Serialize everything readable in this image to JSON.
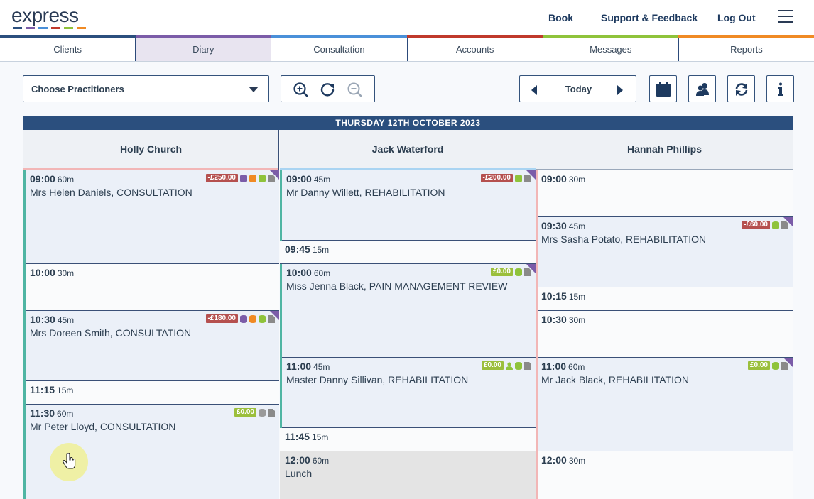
{
  "brand": {
    "logo_text": "express",
    "stripe_colors": [
      "#2b4f7e",
      "#7b5ca8",
      "#4a90d9",
      "#c0392b",
      "#8fc33b",
      "#f08a24"
    ]
  },
  "top_nav": {
    "book": "Book",
    "support": "Support & Feedback",
    "logout": "Log Out"
  },
  "tabs": [
    {
      "label": "Clients"
    },
    {
      "label": "Diary",
      "active": true
    },
    {
      "label": "Consultation"
    },
    {
      "label": "Accounts"
    },
    {
      "label": "Messages"
    },
    {
      "label": "Reports"
    }
  ],
  "toolbar": {
    "practitioners_label": "Choose Practitioners",
    "today_label": "Today",
    "icons": [
      "zoom-in-icon",
      "refresh-icon",
      "zoom-out-icon",
      "calendar-icon",
      "users-icon",
      "sync-icon",
      "info-icon"
    ]
  },
  "date_header": "THURSDAY 12TH OCTOBER 2023",
  "practitioners": [
    {
      "name": "Holly Church",
      "color": "#f2b6b6",
      "slots": [
        {
          "time": "09:00",
          "dur": "60m",
          "who": "Mrs Helen Daniels, CONSULTATION",
          "money": "-£250.00",
          "coins": [
            "#7b5ca8",
            "#f08a24",
            "#8fc33b"
          ],
          "booked": true
        },
        {
          "time": "10:00",
          "dur": "30m"
        },
        {
          "time": "10:30",
          "dur": "45m",
          "who": "Mrs Doreen Smith, CONSULTATION",
          "money": "-£180.00",
          "coins": [
            "#7b5ca8",
            "#f08a24",
            "#8fc33b"
          ],
          "booked": true
        },
        {
          "time": "11:15",
          "dur": "15m"
        },
        {
          "time": "11:30",
          "dur": "60m",
          "who": "Mr Peter Lloyd, CONSULTATION",
          "money": "£0.00",
          "coins": [
            "#9a9a9a"
          ],
          "booked": true
        }
      ]
    },
    {
      "name": "Jack Waterford",
      "color": "#a9d4f2",
      "slots": [
        {
          "time": "09:00",
          "dur": "45m",
          "who": "Mr Danny Willett, REHABILITATION",
          "money": "-£200.00",
          "coins": [
            "#8fc33b"
          ],
          "booked": true
        },
        {
          "time": "09:45",
          "dur": "15m"
        },
        {
          "time": "10:00",
          "dur": "60m",
          "who": "Miss Jenna Black, PAIN MANAGEMENT REVIEW",
          "money": "£0.00",
          "coins": [
            "#8fc33b"
          ],
          "booked": true
        },
        {
          "time": "11:00",
          "dur": "45m",
          "who": "Master Danny Sillivan, REHABILITATION",
          "money": "£0.00",
          "coins": [
            "#8fc33b"
          ],
          "person": true,
          "booked": true
        },
        {
          "time": "11:45",
          "dur": "15m"
        },
        {
          "time": "12:00",
          "dur": "60m",
          "who": "Lunch",
          "lunch": true
        }
      ]
    },
    {
      "name": "Hannah Phillips",
      "color": "#f2b6b6",
      "slots": [
        {
          "time": "09:00",
          "dur": "30m"
        },
        {
          "time": "09:30",
          "dur": "45m",
          "who": "Mrs Sasha Potato, REHABILITATION",
          "money": "-£60.00",
          "coins": [
            "#8fc33b"
          ],
          "booked": true
        },
        {
          "time": "10:15",
          "dur": "15m"
        },
        {
          "time": "10:30",
          "dur": "30m"
        },
        {
          "time": "11:00",
          "dur": "60m",
          "who": "Mr Jack Black, REHABILITATION",
          "money": "£0.00",
          "coins": [
            "#8fc33b"
          ],
          "booked": true
        },
        {
          "time": "12:00",
          "dur": "30m"
        }
      ]
    }
  ]
}
